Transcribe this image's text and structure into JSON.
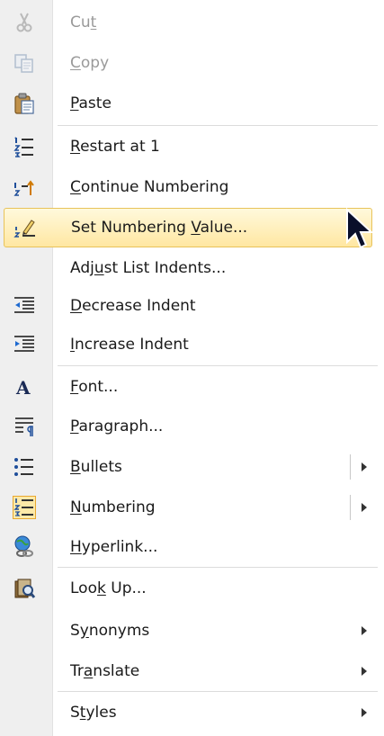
{
  "menu": {
    "items": [
      {
        "label": "Cut",
        "accel": "t",
        "icon": "cut-icon",
        "disabled": true
      },
      {
        "label": "Copy",
        "accel": "C",
        "icon": "copy-icon",
        "disabled": true
      },
      {
        "label": "Paste",
        "accel": "P",
        "icon": "paste-icon"
      },
      {
        "label": "Restart at 1",
        "accel": "R",
        "icon": "restart-numbering-icon"
      },
      {
        "label": "Continue Numbering",
        "accel": "C",
        "icon": "continue-numbering-icon"
      },
      {
        "label": "Set Numbering Value...",
        "accel": "V",
        "icon": "set-numbering-value-icon",
        "highlighted": true
      },
      {
        "label": "Adjust List Indents...",
        "accel": "u",
        "icon": null
      },
      {
        "label": "Decrease Indent",
        "accel": "D",
        "icon": "decrease-indent-icon"
      },
      {
        "label": "Increase Indent",
        "accel": "I",
        "icon": "increase-indent-icon"
      },
      {
        "label": "Font...",
        "accel": "F",
        "icon": "font-icon"
      },
      {
        "label": "Paragraph...",
        "accel": "P",
        "icon": "paragraph-icon"
      },
      {
        "label": "Bullets",
        "accel": "B",
        "icon": "bullets-icon",
        "submenu": true,
        "split": true
      },
      {
        "label": "Numbering",
        "accel": "N",
        "icon": "numbering-icon",
        "submenu": true,
        "split": true,
        "checked": true
      },
      {
        "label": "Hyperlink...",
        "accel": "H",
        "icon": "hyperlink-icon"
      },
      {
        "label": "Look Up...",
        "accel": "k",
        "icon": "look-up-icon"
      },
      {
        "label": "Synonyms",
        "accel": "y",
        "icon": null,
        "submenu": true
      },
      {
        "label": "Translate",
        "accel": "a",
        "icon": null,
        "submenu": true
      },
      {
        "label": "Styles",
        "accel": "t",
        "icon": null,
        "submenu": true
      }
    ]
  },
  "colors": {
    "highlight_top": "#fff9dc",
    "highlight_bottom": "#ffe7a2",
    "highlight_border": "#e8c35a",
    "gutter": "#efefef",
    "disabled_text": "#9a9a9a"
  }
}
